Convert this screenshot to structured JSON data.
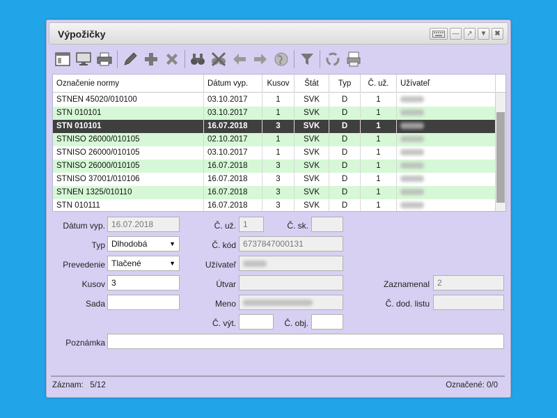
{
  "window": {
    "title": "Výpožičky"
  },
  "toolbar": {
    "icons": [
      "window-icon",
      "monitor-icon",
      "printer-icon",
      "pen-icon",
      "add-icon",
      "delete-icon",
      "binoculars-icon",
      "clear-search-icon",
      "arrow-left-icon",
      "arrow-right-icon",
      "globe-icon",
      "filter-icon",
      "recycle-icon",
      "printer2-icon"
    ]
  },
  "table": {
    "headers": [
      "Označenie normy",
      "Dátum vyp.",
      "Kusov",
      "Štát",
      "Typ",
      "Č. už.",
      "Užívateľ"
    ],
    "rows": [
      {
        "norma": "STNEN 45020/010100",
        "datum": "03.10.2017",
        "kusov": "1",
        "stat": "SVK",
        "typ": "D",
        "cuz": "1"
      },
      {
        "norma": "STN 010101",
        "datum": "03.10.2017",
        "kusov": "1",
        "stat": "SVK",
        "typ": "D",
        "cuz": "1"
      },
      {
        "norma": "STN 010101",
        "datum": "16.07.2018",
        "kusov": "3",
        "stat": "SVK",
        "typ": "D",
        "cuz": "1"
      },
      {
        "norma": "STNISO 26000/010105",
        "datum": "02.10.2017",
        "kusov": "1",
        "stat": "SVK",
        "typ": "D",
        "cuz": "1"
      },
      {
        "norma": "STNISO 26000/010105",
        "datum": "03.10.2017",
        "kusov": "1",
        "stat": "SVK",
        "typ": "D",
        "cuz": "1"
      },
      {
        "norma": "STNISO 26000/010105",
        "datum": "16.07.2018",
        "kusov": "3",
        "stat": "SVK",
        "typ": "D",
        "cuz": "1"
      },
      {
        "norma": "STNISO 37001/010106",
        "datum": "16.07.2018",
        "kusov": "3",
        "stat": "SVK",
        "typ": "D",
        "cuz": "1"
      },
      {
        "norma": "STNEN 1325/010110",
        "datum": "16.07.2018",
        "kusov": "3",
        "stat": "SVK",
        "typ": "D",
        "cuz": "1"
      },
      {
        "norma": "STN 010111",
        "datum": "16.07.2018",
        "kusov": "3",
        "stat": "SVK",
        "typ": "D",
        "cuz": "1"
      }
    ]
  },
  "form": {
    "datum_label": "Dátum vyp.",
    "datum_value": "16.07.2018",
    "typ_label": "Typ",
    "typ_value": "Dlhodobá",
    "prevedenie_label": "Prevedenie",
    "prevedenie_value": "Tlačené",
    "kusov_label": "Kusov",
    "kusov_value": "3",
    "sada_label": "Sada",
    "sada_value": "",
    "cuz_label": "Č. už.",
    "cuz_value": "1",
    "csk_label": "Č. sk.",
    "csk_value": "",
    "ckod_label": "Č. kód",
    "ckod_value": "6737847000131",
    "uzivatel_label": "Užívateľ",
    "utvar_label": "Útvar",
    "utvar_value": "",
    "meno_label": "Meno",
    "cvyt_label": "Č. výt.",
    "cvyt_value": "",
    "cobj_label": "Č. obj.",
    "cobj_value": "",
    "zaznamenal_label": "Zaznamenal",
    "zaznamenal_value": "2",
    "cdod_label": "Č. dod. listu",
    "cdod_value": "",
    "poznamka_label": "Poznámka",
    "poznamka_value": ""
  },
  "status": {
    "zaznam_label": "Záznam:",
    "zaznam_value": "5/12",
    "oznacene": "Označené: 0/0"
  },
  "colors": {
    "background": "#21a5e8",
    "window": "#d8d0f2",
    "row_even": "#d6f8d6",
    "row_selected": "#3f3f3f"
  }
}
